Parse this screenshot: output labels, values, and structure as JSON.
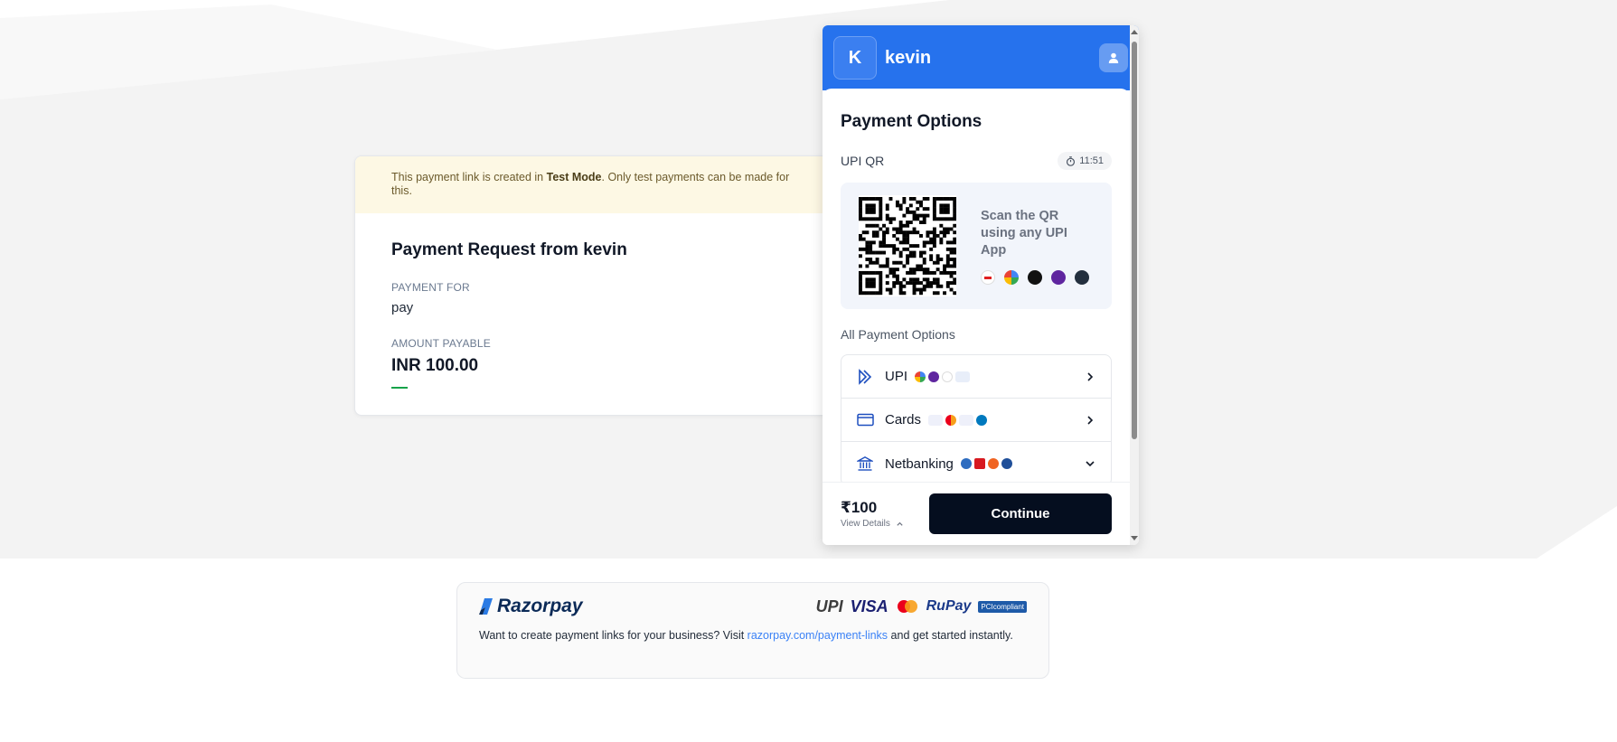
{
  "test_banner": {
    "prefix": "This payment link is created in ",
    "mode": "Test Mode",
    "suffix": ". Only test payments can be made for this."
  },
  "request": {
    "title": "Payment Request from kevin",
    "payment_for_label": "PAYMENT FOR",
    "payment_for_value": "pay",
    "amount_label": "AMOUNT PAYABLE",
    "amount_value": "INR 100.00"
  },
  "checkout": {
    "merchant_initial": "K",
    "merchant_name": "kevin",
    "brand_color": "#2672ed",
    "title": "Payment Options",
    "upi_qr_label": "UPI QR",
    "timer": "11:51",
    "qr_caption": "Scan the QR using any UPI App",
    "upi_apps": [
      "paytm-icon",
      "gpay-icon",
      "cred-icon",
      "phonepe-icon",
      "amazonpay-icon"
    ],
    "all_options_label": "All Payment Options",
    "methods": [
      {
        "label": "UPI",
        "chevron": "right"
      },
      {
        "label": "Cards",
        "chevron": "right"
      },
      {
        "label": "Netbanking",
        "chevron": "down"
      }
    ],
    "footer": {
      "amount": "₹100",
      "view_details": "View Details",
      "continue_label": "Continue"
    }
  },
  "razorpay": {
    "logo_text": "Razorpay",
    "brands": {
      "upi": "UPI",
      "visa": "VISA",
      "rupay": "RuPay",
      "pci": "PCIcompliant"
    },
    "text_before": "Want to create payment links for your business? Visit ",
    "link": "razorpay.com/payment-links",
    "text_after": " and get started instantly."
  }
}
